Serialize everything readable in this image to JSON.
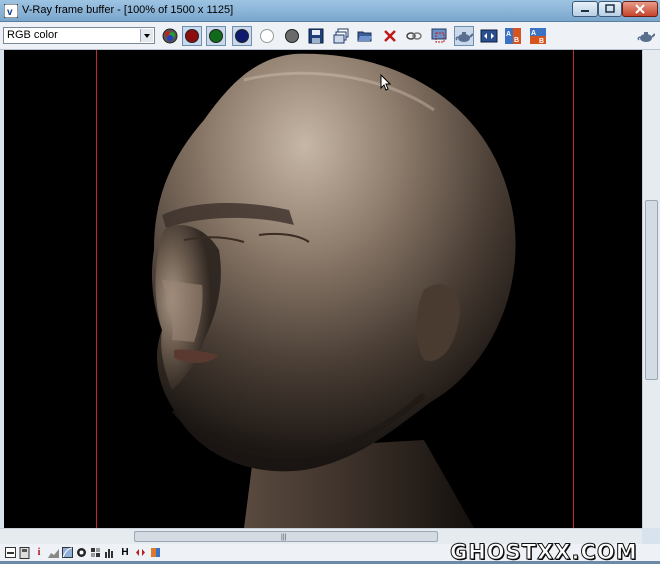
{
  "window": {
    "title": "V-Ray frame buffer - [100% of 1500 x 1125]",
    "controls": {
      "minimize": "minimize-icon",
      "maximize": "maximize-icon",
      "close": "close-icon"
    }
  },
  "toolbar": {
    "channel_select": {
      "value": "RGB color"
    },
    "buttons": [
      {
        "name": "show-rgb-channels",
        "icon": "rgb-circle-icon"
      },
      {
        "name": "red-channel",
        "icon": "red-circle-icon",
        "color": "#8b0d0d"
      },
      {
        "name": "green-channel",
        "icon": "green-circle-icon",
        "color": "#0f6b1b"
      },
      {
        "name": "blue-channel",
        "icon": "blue-circle-icon",
        "color": "#0d1a6e"
      },
      {
        "name": "alpha-channel",
        "icon": "white-circle-icon",
        "color": "#ffffff"
      },
      {
        "name": "monochrome",
        "icon": "grey-circle-icon",
        "color": "#808080"
      },
      {
        "name": "save-image",
        "icon": "floppy-disk-icon"
      },
      {
        "name": "clone-frame-buffer",
        "icon": "clone-window-icon"
      },
      {
        "name": "load-image",
        "icon": "open-folder-icon"
      },
      {
        "name": "clear-image",
        "icon": "red-x-icon"
      },
      {
        "name": "track-mouse",
        "icon": "link-icon"
      },
      {
        "name": "region-render",
        "icon": "region-icon"
      },
      {
        "name": "render-last",
        "icon": "teapot-icon"
      },
      {
        "name": "pixel-info",
        "icon": "pixel-info-icon"
      },
      {
        "name": "ab-compare-horizontal",
        "icon": "ab-horizontal-icon"
      },
      {
        "name": "ab-compare-vertical",
        "icon": "ab-vertical-icon"
      },
      {
        "name": "render",
        "icon": "teapot-icon"
      }
    ]
  },
  "viewport": {
    "image": "rendered-bald-head-closed-eyes",
    "region_lines": "red region render borders"
  },
  "bottombar": {
    "icons": [
      "color-corrections-icon",
      "film-icon",
      "info-icon",
      "levels-icon",
      "curve-icon",
      "exposure-icon",
      "lut-icon",
      "histogram-icon",
      "h-icon",
      "stereo-icon",
      "channels-icon"
    ],
    "h_label": "H",
    "info_label": "i"
  },
  "watermark": "GHOSTXX.COM"
}
